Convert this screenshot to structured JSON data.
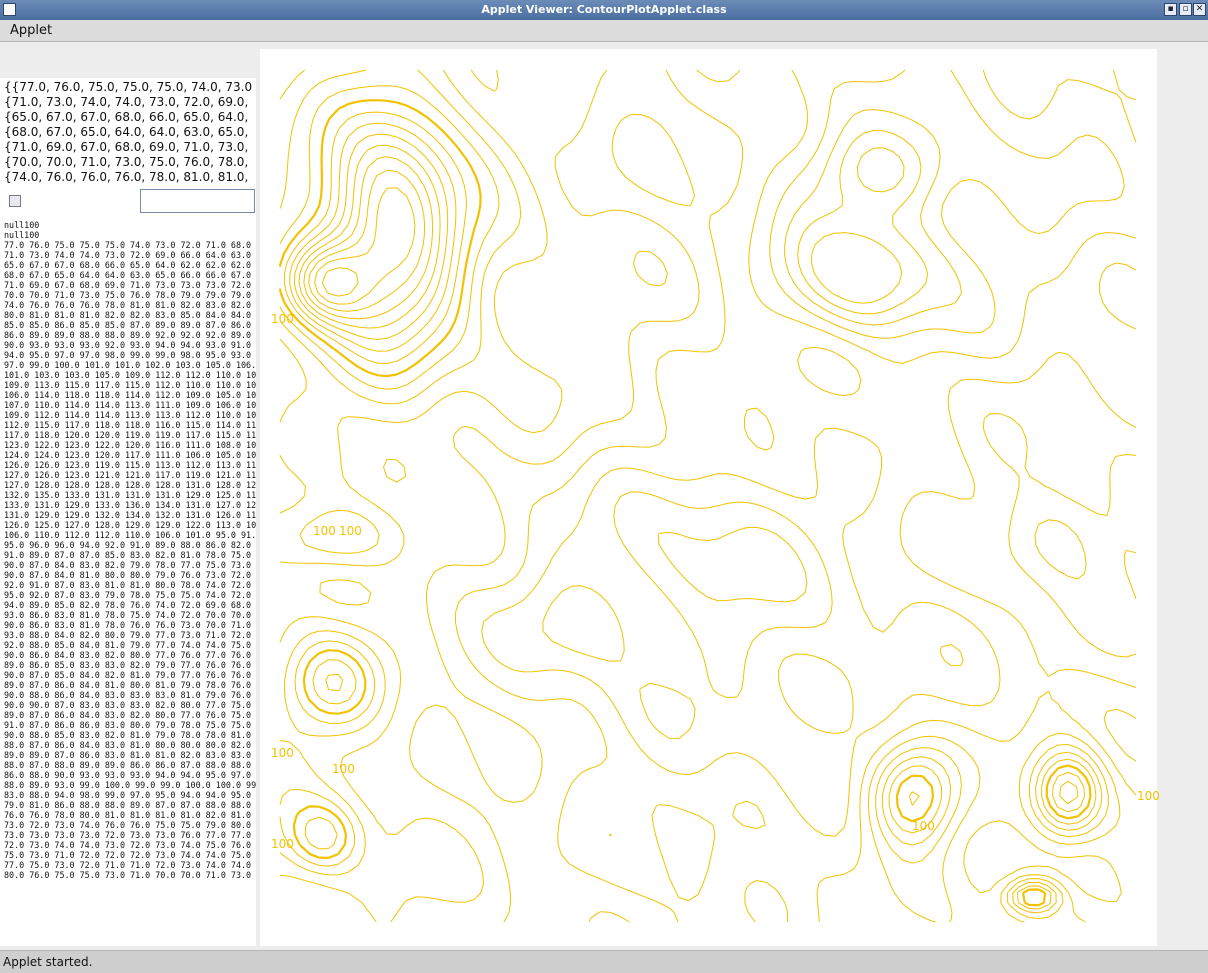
{
  "window": {
    "title": "Applet Viewer: ContourPlotApplet.class",
    "minimize_glyph": "▪",
    "maximize_glyph": "▫",
    "close_glyph": "✕"
  },
  "menubar": {
    "applet_menu": "Applet"
  },
  "top_textarea": {
    "lines": [
      "{{77.0, 76.0, 75.0, 75.0, 75.0, 74.0, 73.0",
      "{71.0, 73.0, 74.0, 74.0, 73.0, 72.0, 69.0,",
      "{65.0, 67.0, 67.0, 68.0, 66.0, 65.0, 64.0,",
      "{68.0, 67.0, 65.0, 64.0, 64.0, 63.0, 65.0,",
      "{71.0, 69.0, 67.0, 68.0, 69.0, 71.0, 73.0,",
      "{70.0, 70.0, 71.0, 73.0, 75.0, 76.0, 78.0,",
      "{74.0, 76.0, 76.0, 76.0, 78.0, 81.0, 81.0,"
    ]
  },
  "controls": {
    "checkbox_checked": false,
    "text_field_value": ""
  },
  "data_textarea": {
    "lines": [
      "null100",
      "null100",
      "77.0 76.0 75.0 75.0 75.0 74.0 73.0 72.0 71.0 68.0",
      "71.0 73.0 74.0 74.0 73.0 72.0 69.0 66.0 64.0 63.0",
      "65.0 67.0 67.0 68.0 66.0 65.0 64.0 62.0 62.0 62.0",
      "68.0 67.0 65.0 64.0 64.0 63.0 65.0 66.0 66.0 67.0",
      "71.0 69.0 67.0 68.0 69.0 71.0 73.0 73.0 73.0 72.0",
      "70.0 70.0 71.0 73.0 75.0 76.0 78.0 79.0 79.0 79.0",
      "74.0 76.0 76.0 76.0 78.0 81.0 81.0 82.0 83.0 82.0",
      "80.0 81.0 81.0 81.0 82.0 82.0 83.0 85.0 84.0 84.0",
      "85.0 85.0 86.0 85.0 85.0 87.0 89.0 89.0 87.0 86.0",
      "86.0 89.0 89.0 88.0 88.0 89.0 92.0 92.0 92.0 89.0",
      "90.0 93.0 93.0 93.0 92.0 93.0 94.0 94.0 93.0 91.0",
      "94.0 95.0 97.0 97.0 98.0 99.0 99.0 98.0 95.0 93.0",
      "97.0 99.0 100.0 101.0 101.0 102.0 103.0 105.0 106.",
      "101.0 103.0 103.0 105.0 109.0 112.0 112.0 110.0 10",
      "109.0 113.0 115.0 117.0 115.0 112.0 110.0 110.0 10",
      "106.0 114.0 118.0 118.0 114.0 112.0 109.0 105.0 10",
      "107.0 110.0 114.0 114.0 113.0 111.0 109.0 106.0 10",
      "109.0 112.0 114.0 114.0 113.0 113.0 112.0 110.0 10",
      "112.0 115.0 117.0 118.0 118.0 116.0 115.0 114.0 11",
      "117.0 118.0 120.0 120.0 119.0 119.0 117.0 115.0 11",
      "123.0 122.0 123.0 122.0 120.0 116.0 111.0 108.0 10",
      "124.0 124.0 123.0 120.0 117.0 111.0 106.0 105.0 10",
      "126.0 126.0 123.0 119.0 115.0 113.0 112.0 113.0 11",
      "127.0 126.0 123.0 121.0 121.0 117.0 119.0 121.0 11",
      "127.0 128.0 128.0 128.0 128.0 128.0 131.0 128.0 12",
      "132.0 135.0 133.0 131.0 131.0 131.0 129.0 125.0 11",
      "133.0 131.0 129.0 133.0 136.0 134.0 131.0 127.0 12",
      "131.0 129.0 129.0 132.0 134.0 132.0 131.0 126.0 11",
      "126.0 125.0 127.0 128.0 129.0 129.0 122.0 113.0 10",
      "106.0 110.0 112.0 112.0 110.0 106.0 101.0 95.0 91.",
      "95.0 96.0 96.0 94.0 92.0 91.0 89.0 88.0 86.0 82.0",
      "91.0 89.0 87.0 87.0 85.0 83.0 82.0 81.0 78.0 75.0",
      "90.0 87.0 84.0 83.0 82.0 79.0 78.0 77.0 75.0 73.0",
      "90.0 87.0 84.0 81.0 80.0 80.0 79.0 76.0 73.0 72.0",
      "92.0 91.0 87.0 83.0 81.0 81.0 80.0 78.0 74.0 72.0",
      "95.0 92.0 87.0 83.0 79.0 78.0 75.0 75.0 74.0 72.0",
      "94.0 89.0 85.0 82.0 78.0 76.0 74.0 72.0 69.0 68.0",
      "93.0 86.0 83.0 81.0 78.0 75.0 74.0 72.0 70.0 70.0",
      "90.0 86.0 83.0 81.0 78.0 76.0 76.0 73.0 70.0 71.0",
      "93.0 88.0 84.0 82.0 80.0 79.0 77.0 73.0 71.0 72.0",
      "92.0 88.0 85.0 84.0 81.0 79.0 77.0 74.0 74.0 75.0",
      "90.0 86.0 84.0 83.0 82.0 80.0 77.0 76.0 77.0 76.0",
      "89.0 86.0 85.0 83.0 83.0 82.0 79.0 77.0 76.0 76.0",
      "90.0 87.0 85.0 84.0 82.0 81.0 79.0 77.0 76.0 76.0",
      "89.0 87.0 86.0 84.0 81.0 80.0 81.0 79.0 78.0 76.0",
      "90.0 88.0 86.0 84.0 83.0 83.0 83.0 81.0 79.0 76.0",
      "90.0 90.0 87.0 83.0 83.0 83.0 82.0 80.0 77.0 75.0",
      "89.0 87.0 86.0 84.0 83.0 82.0 80.0 77.0 76.0 75.0",
      "91.0 87.0 86.0 86.0 83.0 80.0 79.0 78.0 75.0 75.0",
      "90.0 88.0 85.0 83.0 82.0 81.0 79.0 78.0 78.0 81.0",
      "88.0 87.0 86.0 84.0 83.0 81.0 80.0 80.0 80.0 82.0",
      "89.0 89.0 87.0 86.0 83.0 81.0 81.0 82.0 83.0 83.0",
      "88.0 87.0 88.0 89.0 89.0 86.0 86.0 87.0 88.0 88.0",
      "86.0 88.0 90.0 93.0 93.0 93.0 94.0 94.0 95.0 97.0",
      "88.0 89.0 93.0 99.0 100.0 99.0 99.0 100.0 100.0 99",
      "83.0 88.0 94.0 98.0 99.0 97.0 95.0 94.0 94.0 95.0",
      "79.0 81.0 86.0 88.0 88.0 89.0 87.0 87.0 88.0 88.0",
      "76.0 76.0 78.0 80.0 81.0 81.0 81.0 81.0 82.0 81.0",
      "73.0 72.0 73.0 74.0 76.0 76.0 75.0 75.0 79.0 80.0",
      "73.0 73.0 73.0 73.0 72.0 73.0 73.0 76.0 77.0 77.0",
      "72.0 73.0 74.0 74.0 73.0 72.0 73.0 74.0 75.0 76.0",
      "75.0 73.0 71.0 72.0 72.0 72.0 73.0 74.0 74.0 75.0",
      "77.0 75.0 73.0 72.0 71.0 71.0 72.0 73.0 74.0 74.0",
      "80.0 76.0 75.0 75.0 73.0 71.0 70.0 70.0 71.0 73.0"
    ]
  },
  "contour_plot": {
    "line_color": "#f2c200",
    "labels": [
      "100",
      "100",
      "100",
      "100",
      "100",
      "100",
      "100",
      "100"
    ]
  },
  "status": {
    "text": "Applet started."
  }
}
